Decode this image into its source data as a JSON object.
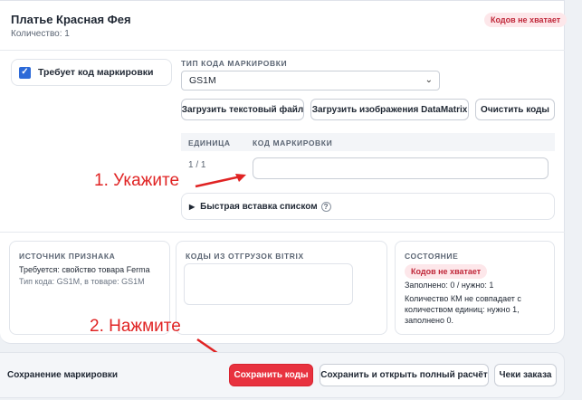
{
  "product": {
    "title": "Платье Красная Фея",
    "quantity": "Количество: 1",
    "status_badge": "Кодов не хватает"
  },
  "marking": {
    "requires_label": "Требует код маркировки",
    "requires_checked": true,
    "type_label": "ТИП КОДА МАРКИРОВКИ",
    "type_value": "GS1M",
    "buttons": {
      "upload_text": "Загрузить текстовый файл",
      "upload_images": "Загрузить изображения DataMatrix",
      "clear": "Очистить коды"
    },
    "table": {
      "col_unit": "ЕДИНИЦА",
      "col_code": "КОД МАРКИРОВКИ",
      "rows": [
        {
          "unit": "1 / 1",
          "code": ""
        }
      ]
    },
    "quick_paste": "Быстрая вставка списком",
    "help_glyph": "?"
  },
  "panels": {
    "source": {
      "title": "ИСТОЧНИК ПРИЗНАКА",
      "line1": "Требуется: свойство товара Ferma",
      "line2": "Тип кода: GS1M, в товаре: GS1M"
    },
    "bitrix": {
      "title": "КОДЫ ИЗ ОТГРУЗОК BITRIX"
    },
    "state": {
      "title": "СОСТОЯНИЕ",
      "badge": "Кодов не хватает",
      "filled": "Заполнено: 0 / нужно: 1",
      "message": "Количество КМ не совпадает с количеством единиц: нужно 1, заполнено 0."
    }
  },
  "annotations": {
    "step1": "1. Укажите",
    "step2": "2. Нажмите",
    "color": "#e02323"
  },
  "footer": {
    "label": "Сохранение маркировки",
    "save": "Сохранить коды",
    "save_open": "Сохранить и открыть полный расчёт",
    "receipts": "Чеки заказа"
  },
  "colors": {
    "accent": "#2d6ad8",
    "danger": "#e8323f",
    "danger_text": "#c0283a",
    "danger_bg": "#fde7ea"
  }
}
